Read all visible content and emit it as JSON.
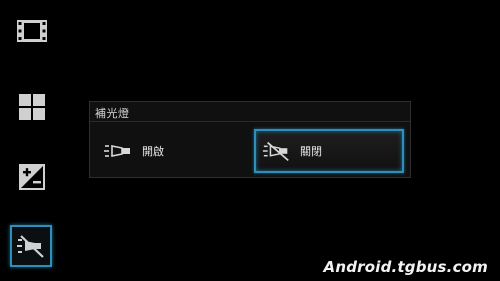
{
  "sidebar": {
    "items": [
      {
        "icon": "film-icon"
      },
      {
        "icon": "grid-icon"
      },
      {
        "icon": "exposure-icon"
      },
      {
        "icon": "flash-off-icon",
        "active": true
      }
    ]
  },
  "flash_panel": {
    "title": "補光燈",
    "options": [
      {
        "label": "開啟",
        "icon": "flash-on-icon",
        "selected": false
      },
      {
        "label": "關閉",
        "icon": "flash-off-icon",
        "selected": true
      }
    ]
  },
  "watermark": "Android.tgbus.com",
  "colors": {
    "accent": "#2f8fb8",
    "background": "#000000",
    "icon": "#d0d0d0"
  }
}
